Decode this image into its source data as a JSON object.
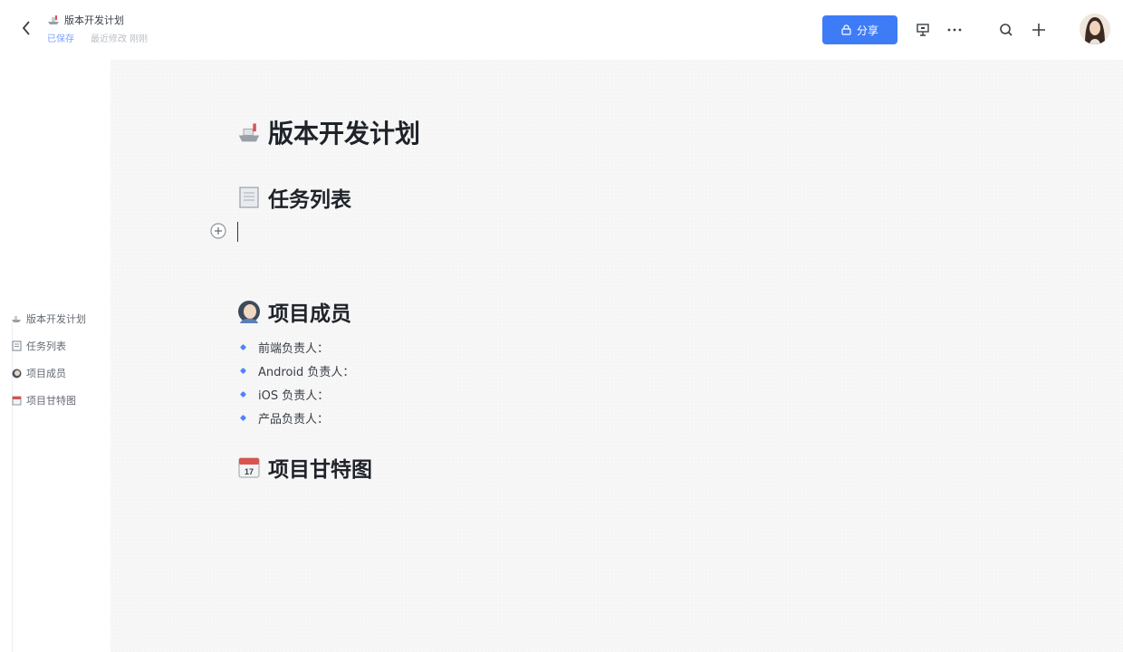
{
  "header": {
    "title": "版本开发计划",
    "tag_label": "已保存",
    "time_label": "最近修改 刚刚",
    "share_label": "分享"
  },
  "toolbar_icons": [
    "back-icon",
    "present-icon",
    "more-icon",
    "search-icon",
    "add-icon",
    "avatar"
  ],
  "toc": [
    {
      "icon": "ship-icon",
      "label": "版本开发计划"
    },
    {
      "icon": "notebook-icon",
      "label": "任务列表"
    },
    {
      "icon": "person-icon",
      "label": "项目成员"
    },
    {
      "icon": "calendar-icon",
      "label": "项目甘特图"
    }
  ],
  "doc": {
    "title": "版本开发计划",
    "sections": {
      "tasks": "任务列表",
      "members": "项目成员",
      "gantt": "项目甘特图"
    },
    "members_list": [
      "前端负责人：",
      "Android 负责人：",
      "iOS 负责人：",
      "产品负责人："
    ],
    "calendar_day": "17"
  },
  "colors": {
    "accent": "#3e7cf7",
    "bullet": "#4e83fd",
    "canvas_bg": "#f7f7f7"
  }
}
